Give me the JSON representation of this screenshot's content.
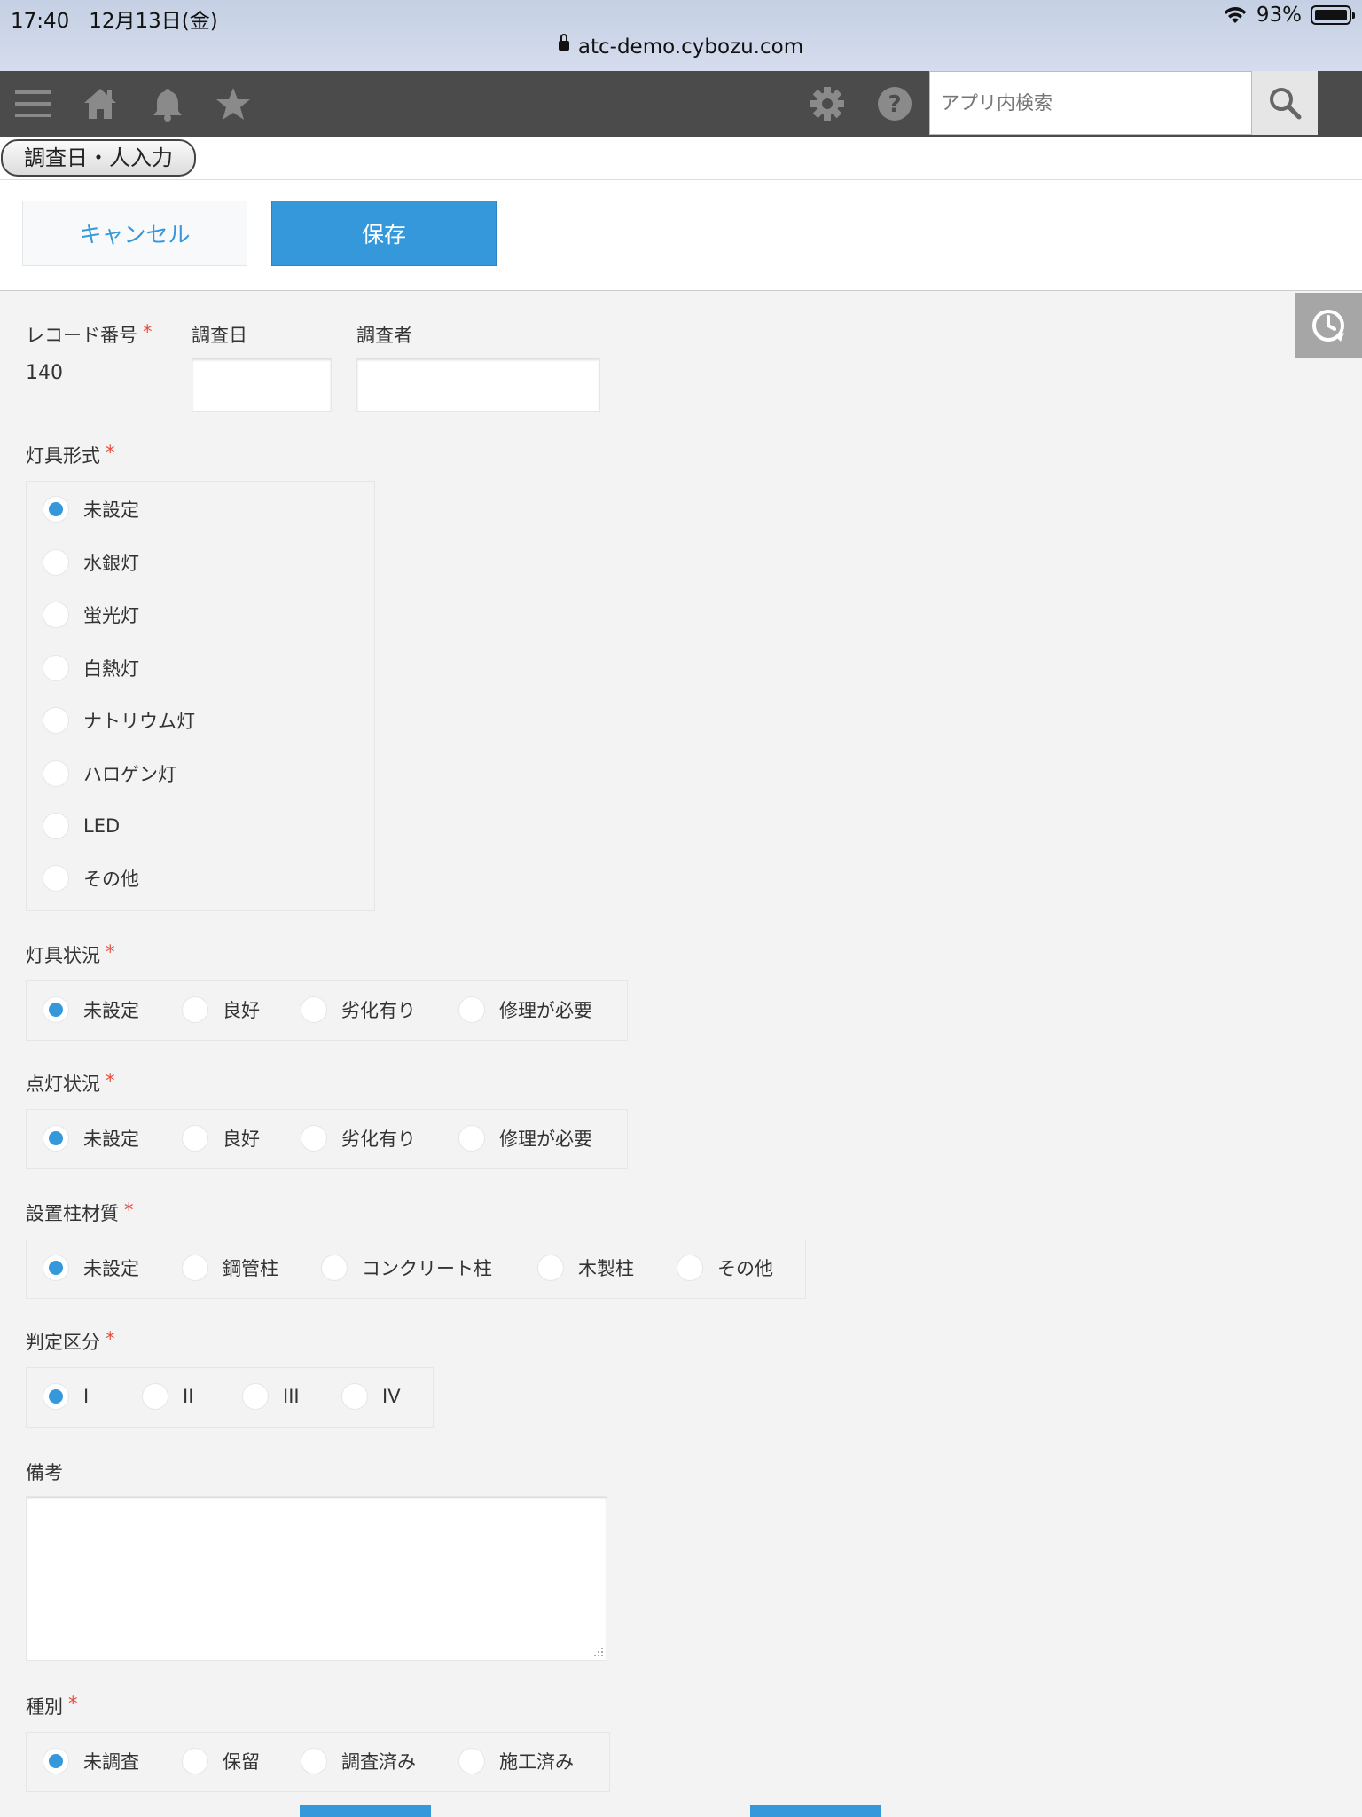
{
  "status_bar": {
    "time": "17:40",
    "date": "12月13日(金)",
    "battery": "93%",
    "url": "atc-demo.cybozu.com"
  },
  "toolbar": {
    "menu_icon": "hamburger-menu-icon",
    "home_icon": "home-icon",
    "notification_icon": "bell-icon",
    "favorite_icon": "star-icon",
    "settings_icon": "gear-icon",
    "help_icon": "question-icon",
    "search_placeholder": "アプリ内検索",
    "search_icon": "search-icon"
  },
  "page_title": "調査日・人入力",
  "actions": {
    "cancel": "キャンセル",
    "save": "保存"
  },
  "colors": {
    "accent": "#3498db",
    "required": "#e74c3c",
    "toolbar": "#4b4b4b"
  },
  "form": {
    "record_number": {
      "label": "レコード番号",
      "required_mark": "*",
      "value": "140"
    },
    "survey_date": {
      "label": "調査日",
      "value": ""
    },
    "surveyor": {
      "label": "調査者",
      "value": ""
    },
    "fixture_type": {
      "label": "灯具形式",
      "required_mark": "*",
      "selected": "未設定",
      "options": [
        "未設定",
        "水銀灯",
        "蛍光灯",
        "白熱灯",
        "ナトリウム灯",
        "ハロゲン灯",
        "LED",
        "その他"
      ]
    },
    "fixture_condition": {
      "label": "灯具状況",
      "required_mark": "*",
      "selected": "未設定",
      "options": [
        "未設定",
        "良好",
        "劣化有り",
        "修理が必要"
      ]
    },
    "lighting_condition": {
      "label": "点灯状況",
      "required_mark": "*",
      "selected": "未設定",
      "options": [
        "未設定",
        "良好",
        "劣化有り",
        "修理が必要"
      ]
    },
    "pole_material": {
      "label": "設置柱材質",
      "required_mark": "*",
      "selected": "未設定",
      "options": [
        "未設定",
        "鋼管柱",
        "コンクリート柱",
        "木製柱",
        "その他"
      ]
    },
    "judgment": {
      "label": "判定区分",
      "required_mark": "*",
      "selected": "I",
      "options": [
        "I",
        "II",
        "III",
        "IV"
      ]
    },
    "remarks": {
      "label": "備考",
      "value": ""
    },
    "category": {
      "label": "種別",
      "required_mark": "*",
      "selected": "未調査",
      "options": [
        "未調査",
        "保留",
        "調査済み",
        "施工済み"
      ]
    }
  }
}
